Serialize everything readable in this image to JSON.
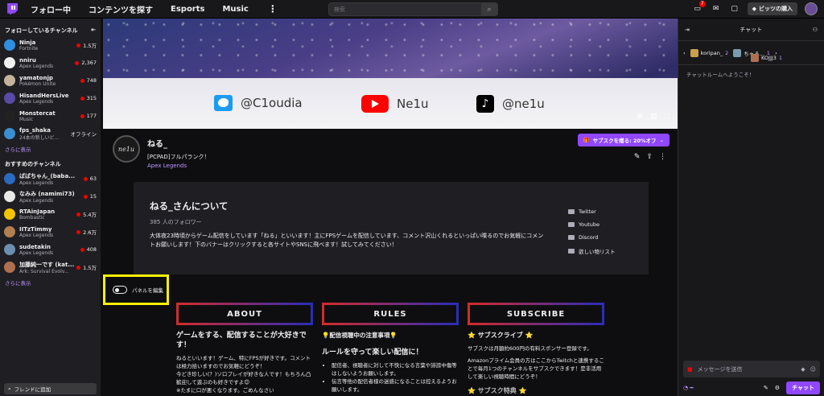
{
  "nav": {
    "following": "フォロー中",
    "browse": "コンテンツを探す",
    "esports": "Esports",
    "music": "Music",
    "more": "⋮"
  },
  "search": {
    "placeholder": "検索"
  },
  "topbar": {
    "notif_count": "7",
    "bits_label": "ビッツの購入"
  },
  "sidebar": {
    "following_title": "フォローしているチャンネル",
    "following": [
      {
        "name": "Ninja",
        "game": "Fortnite",
        "viewers": "1.5万",
        "live": true,
        "color": "#2e8fe0"
      },
      {
        "name": "nniru",
        "game": "Apex Legends",
        "viewers": "2,367",
        "live": true,
        "color": "#f0f0f0"
      },
      {
        "name": "yamatonjp",
        "game": "Pokémon Unite",
        "viewers": "748",
        "live": true,
        "color": "#c4b49a"
      },
      {
        "name": "HisandHersLive",
        "game": "Apex Legends",
        "viewers": "315",
        "live": true,
        "color": "#5a4aa8"
      },
      {
        "name": "Monstercat",
        "game": "Music",
        "viewers": "177",
        "live": true,
        "color": "#222"
      },
      {
        "name": "fps_shaka",
        "game": "24本の新しいビ...",
        "viewers": "オフライン",
        "live": false,
        "color": "#3a8fd0"
      }
    ],
    "more1": "さらに表示",
    "rec_title": "おすすめのチャンネル",
    "recommended": [
      {
        "name": "ばばちゃん_(baba...",
        "game": "Apex Legends",
        "viewers": "63",
        "color": "#2a6abf"
      },
      {
        "name": "なみみ (namimi73)",
        "game": "Apex Legends",
        "viewers": "15",
        "color": "#e8e8e8"
      },
      {
        "name": "RTAinJapan",
        "game": "Bombastic",
        "viewers": "5.4万",
        "color": "#f5c400"
      },
      {
        "name": "IITzTimmy",
        "game": "Apex Legends",
        "viewers": "2.6万",
        "color": "#b08050"
      },
      {
        "name": "sudetakin",
        "game": "Apex Legends",
        "viewers": "408",
        "color": "#6a8fb0"
      },
      {
        "name": "加藤純一です (kat...",
        "game": "Ark: Survival Evolv...",
        "viewers": "1.5万",
        "color": "#b07050"
      }
    ],
    "more2": "さらに表示",
    "friend_search": "フレンドに追加"
  },
  "banner": {
    "twitter": "@C1oudia",
    "youtube": "Ne1u",
    "tiktok": "@ne1u"
  },
  "channel": {
    "avatar_text": "ne1u",
    "name": "ねる_",
    "title": "[PCPAD]フルパランク！",
    "game": "Apex Legends",
    "sub_button": "サブスクを贈る: 20%オフ"
  },
  "about": {
    "title": "ねる_さんについて",
    "followers": "385 人のフォロワー",
    "desc": "大体夜23時頃からゲーム配信をしています「ねる」といいます！主にFPSゲームを配信しています、コメント沢山くれるといっぱい喋るのでお気軽にコメントお願いします！下のバナーはクリックすると各サイトやSNSに飛べます！試してみてください！",
    "links": [
      "Twitter",
      "Youtube",
      "Discord",
      "欲しい物リスト"
    ]
  },
  "edit_panels": "パネルを編集",
  "panels": [
    {
      "title": "ABOUT",
      "heading": "ゲームをする、配信することが大好きです！",
      "text": [
        "ねるといいます！ゲーム、特にFPSが好きです。コメントは極力拾いますのでお気軽にどうぞ！",
        "今どき珍しい(？)ソロプレイが好きな人です！もちろん凸歓迎して遊ぶのも好きですよ😊",
        "※たまに口が悪くなります。ごめんなさい"
      ]
    },
    {
      "title": "RULES",
      "heading": "💡配信視聴中の注意事項💡",
      "heading2": "ルールを守って楽しい配信に！",
      "text": [
        "配信者、視聴者に対して不快になる言葉や誹謗中傷等はしないようお願いします。",
        "伝言等他の配信者様の迷惑になることは控えるようお願いします。"
      ]
    },
    {
      "title": "SUBSCRIBE",
      "heading": "⭐ サブスクライブ ⭐",
      "text": [
        "サブスクは月額約600円の有料スポンサー登録です。",
        "Amazonプライム会員の方はここからTwitchと連携することで毎月1つのチャンネルをサブスクできます！是非活用して楽しい視聴時間にどうぞ！"
      ],
      "heading3": "⭐ サブスク特典 ⭐"
    }
  ],
  "chat": {
    "title": "チャット",
    "gifters": [
      {
        "name": "koripan_",
        "count": "2"
      },
      {
        "name": "ちゃる...",
        "count": "1"
      },
      {
        "name": "KOJJJ3",
        "count": "1"
      }
    ],
    "welcome": "チャットルームへようこそ！",
    "input_placeholder": "メッセージを送信",
    "send": "チャット"
  }
}
